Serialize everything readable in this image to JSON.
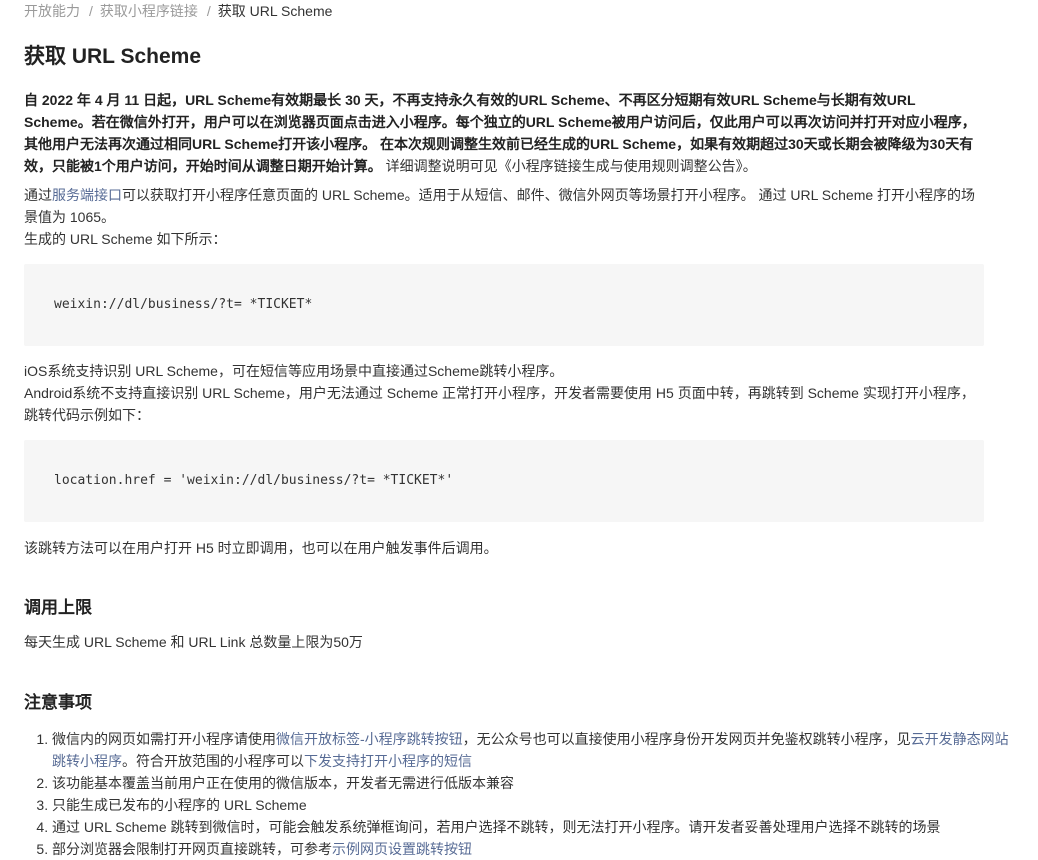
{
  "breadcrumb": {
    "item1": "开放能力",
    "item2": "获取小程序链接",
    "current": "获取 URL Scheme",
    "separator": "/"
  },
  "title": "获取 URL Scheme",
  "notice": {
    "bold": "自 2022 年 4 月 11 日起，URL Scheme有效期最长 30 天，不再支持永久有效的URL Scheme、不再区分短期有效URL Scheme与长期有效URL Scheme。若在微信外打开，用户可以在浏览器页面点击进入小程序。每个独立的URL Scheme被用户访问后，仅此用户可以再次访问并打开对应小程序，其他用户无法再次通过相同URL Scheme打开该小程序。 在本次规则调整生效前已经生成的URL Scheme，如果有效期超过30天或长期会被降级为30天有效，只能被1个用户访问，开始时间从调整日期开始计算。",
    "tail": " 详细调整说明可见",
    "link": "《小程序链接生成与使用规则调整公告》",
    "end": "。"
  },
  "intro": {
    "pre": "通过",
    "link": "服务端接口",
    "post": "可以获取打开小程序任意页面的 URL Scheme。适用于从短信、邮件、微信外网页等场景打开小程序。 通过 URL Scheme 打开小程序的场景值为 1065。",
    "generated": "生成的 URL Scheme 如下所示："
  },
  "code1": "weixin://dl/business/?t= *TICKET*",
  "ios_text": "iOS系统支持识别 URL Scheme，可在短信等应用场景中直接通过Scheme跳转小程序。",
  "android_text": "Android系统不支持直接识别 URL Scheme，用户无法通过 Scheme 正常打开小程序，开发者需要使用 H5 页面中转，再跳转到 Scheme 实现打开小程序，跳转代码示例如下：",
  "code2": "location.href = 'weixin://dl/business/?t= *TICKET*'",
  "after_code2": "该跳转方法可以在用户打开 H5 时立即调用，也可以在用户触发事件后调用。",
  "limit": {
    "heading": "调用上限",
    "text": "每天生成 URL Scheme 和 URL Link 总数量上限为50万"
  },
  "notes": {
    "heading": "注意事项",
    "item1": {
      "pre": "微信内的网页如需打开小程序请使用",
      "link1": "微信开放标签-小程序跳转按钮",
      "mid": "，无公众号也可以直接使用小程序身份开发网页并免鉴权跳转小程序，见",
      "link2": "云开发静态网站跳转小程序",
      "mid2": "。符合开放范围的小程序可以",
      "link3": "下发支持打开小程序的短信"
    },
    "item2": "该功能基本覆盖当前用户正在使用的微信版本，开发者无需进行低版本兼容",
    "item3": "只能生成已发布的小程序的 URL Scheme",
    "item4": "通过 URL Scheme 跳转到微信时，可能会触发系统弹框询问，若用户选择不跳转，则无法打开小程序。请开发者妥善处理用户选择不跳转的场景",
    "item5": {
      "pre": "部分浏览器会限制打开网页直接跳转，可参考",
      "link": "示例网页设置跳转按钮"
    }
  }
}
